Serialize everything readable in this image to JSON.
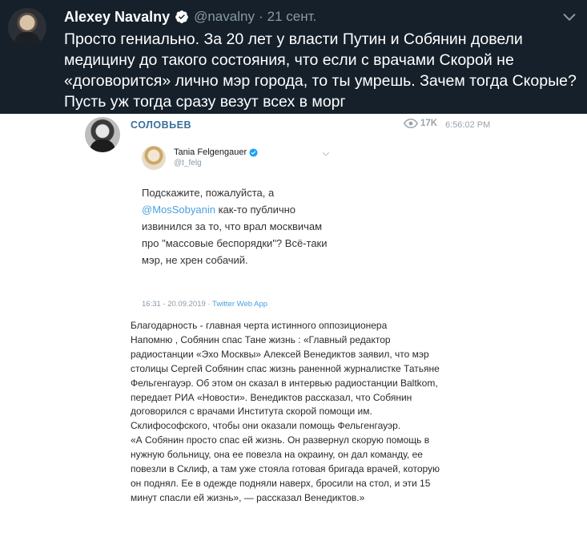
{
  "tweet": {
    "author": "Alexey Navalny",
    "handle": "@navalny",
    "separator": "·",
    "date": "21 сент.",
    "text": "Просто гениально. За 20 лет у власти Путин и Собянин довели медицину до такого состояния, что если с врачами Скорой не «договорится» лично мэр города, то ты умрешь. Зачем тогда Скорые? Пусть уж тогда сразу везут всех в морг",
    "icons": {
      "verified": "verified-badge-icon",
      "menu": "chevron-down-icon"
    }
  },
  "post": {
    "channel": "СОЛОВЬЕВ",
    "views": "17K",
    "time": "6:56:02 PM",
    "embedded_tweet": {
      "name": "Tania Felgengauer",
      "handle": "@t_felg",
      "text_before": "Подскажите, пожалуйста, а ",
      "mention": "@MosSobyanin",
      "text_after": " как-то публично извинился за то, что врал москвичам про \"массовые беспорядки\"? Всё-таки мэр, не хрен собачий.",
      "timestamp": "16:31 - 20.09.2019 · ",
      "app": "Twitter Web App"
    },
    "body": [
      "Благодарность - главная черта истинного оппозиционера",
      "Напомню , Собянин спас Тане жизнь : «Главный редактор радиостанции «Эхо Москвы» Алексей Венедиктов заявил, что мэр столицы Сергей Собянин спас жизнь раненной журналистке Татьяне Фельгенгауэр. Об этом он сказал в интервью радиостанции Baltkom, передает РИА «Новости». Венедиктов рассказал, что Собянин договорился с врачами Института скорой помощи им. Склифософского, чтобы они оказали помощь Фельгенгауэр.",
      "«А Собянин просто спас ей жизнь. Он развернул скорую помощь в нужную больницу, она ее повезла на окраину, он дал команду, ее повезли в Склиф, а там уже стояла готовая бригада врачей, которую он поднял. Ее в одежде подняли наверх, бросили на стол, и эти 15 минут спасли ей жизнь», — рассказал Венедиктов.»"
    ]
  },
  "colors": {
    "dark_bg": "#15202b",
    "muted": "#8899a6",
    "twitter_blue": "#1da1f2",
    "channel_blue": "#3b6e9a"
  }
}
